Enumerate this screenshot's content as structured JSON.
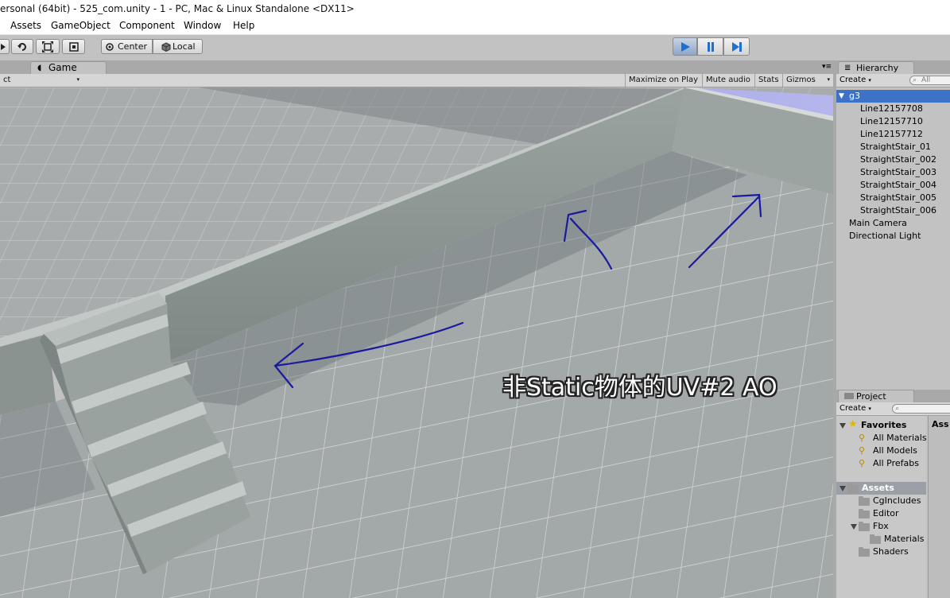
{
  "window": {
    "title": "ersonal (64bit) - 525_com.unity - 1 - PC, Mac & Linux Standalone <DX11>"
  },
  "menu": [
    "Assets",
    "GameObject",
    "Component",
    "Window",
    "Help"
  ],
  "toolbar": {
    "pivot_label": "Center",
    "space_label": "Local"
  },
  "game": {
    "tab_label": "Game",
    "aspect_label": "ct",
    "buttons": [
      "Maximize on Play",
      "Mute audio",
      "Stats",
      "Gizmos"
    ],
    "annotation": "非Static物体的UV#2 AO"
  },
  "hierarchy": {
    "tab_label": "Hierarchy",
    "create_label": "Create",
    "search_placeholder": "All",
    "items": [
      {
        "label": "g3"
      },
      {
        "label": "Line12157708"
      },
      {
        "label": "Line12157710"
      },
      {
        "label": "Line12157712"
      },
      {
        "label": "StraightStair_01"
      },
      {
        "label": "StraightStair_002"
      },
      {
        "label": "StraightStair_003"
      },
      {
        "label": "StraightStair_004"
      },
      {
        "label": "StraightStair_005"
      },
      {
        "label": "StraightStair_006"
      },
      {
        "label": "Main Camera"
      },
      {
        "label": "Directional Light"
      }
    ]
  },
  "project": {
    "tab_label": "Project",
    "create_label": "Create",
    "favorites_label": "Favorites",
    "favorites": [
      "All Materials",
      "All Models",
      "All Prefabs"
    ],
    "assets_label": "Assets",
    "folders": [
      "CgIncludes",
      "Editor",
      "Fbx",
      "Materials",
      "Shaders"
    ],
    "right_header": "Ass"
  },
  "colors": {
    "selection": "#3d72c6",
    "panel_bg": "#c2c2c2",
    "annotation_arrow": "#1a1aa0"
  }
}
